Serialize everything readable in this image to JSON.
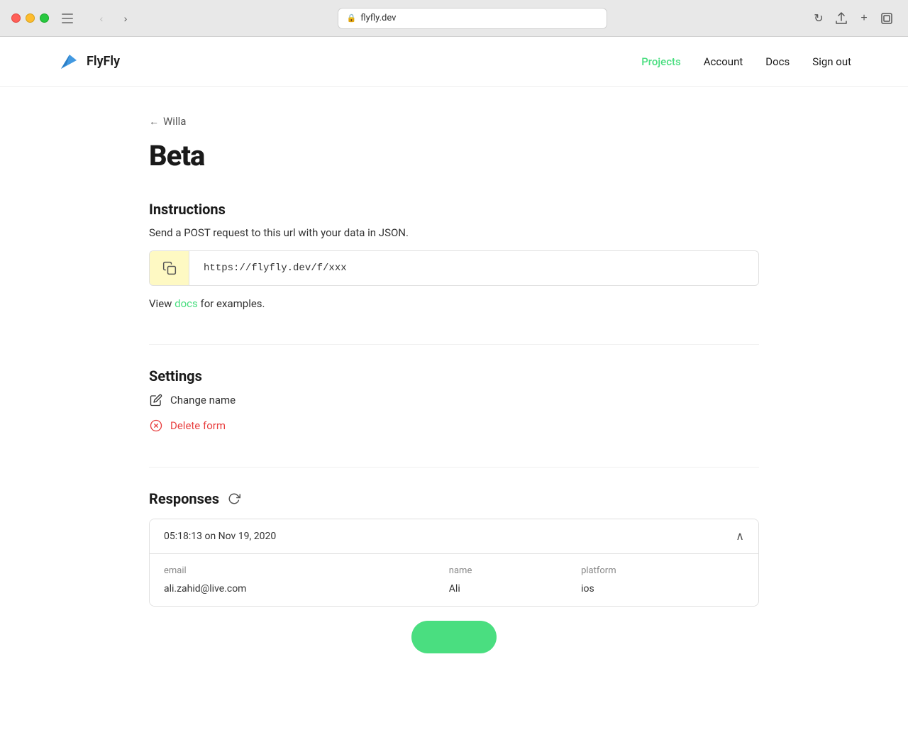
{
  "browser": {
    "url": "flyfly.dev",
    "lock_icon": "🔒",
    "reload_icon": "↻"
  },
  "nav": {
    "logo_text": "FlyFly",
    "links": [
      {
        "id": "projects",
        "label": "Projects",
        "active": true
      },
      {
        "id": "account",
        "label": "Account",
        "active": false
      },
      {
        "id": "docs",
        "label": "Docs",
        "active": false
      },
      {
        "id": "signout",
        "label": "Sign out",
        "active": false
      }
    ]
  },
  "breadcrumb": {
    "arrow": "←",
    "parent": "Willa"
  },
  "page": {
    "title": "Beta"
  },
  "instructions": {
    "title": "Instructions",
    "description": "Send a POST request to this url with your data in JSON.",
    "url": "https://flyfly.dev/f/xxx",
    "view_docs_prefix": "View ",
    "docs_link_label": "docs",
    "view_docs_suffix": " for examples."
  },
  "settings": {
    "title": "Settings",
    "change_name_label": "Change name",
    "delete_form_label": "Delete form"
  },
  "responses": {
    "title": "Responses",
    "timestamp": "05:18:13 on Nov 19, 2020",
    "columns": [
      "email",
      "name",
      "platform"
    ],
    "rows": [
      {
        "email": "ali.zahid@live.com",
        "name": "Ali",
        "platform": "ios"
      }
    ]
  }
}
